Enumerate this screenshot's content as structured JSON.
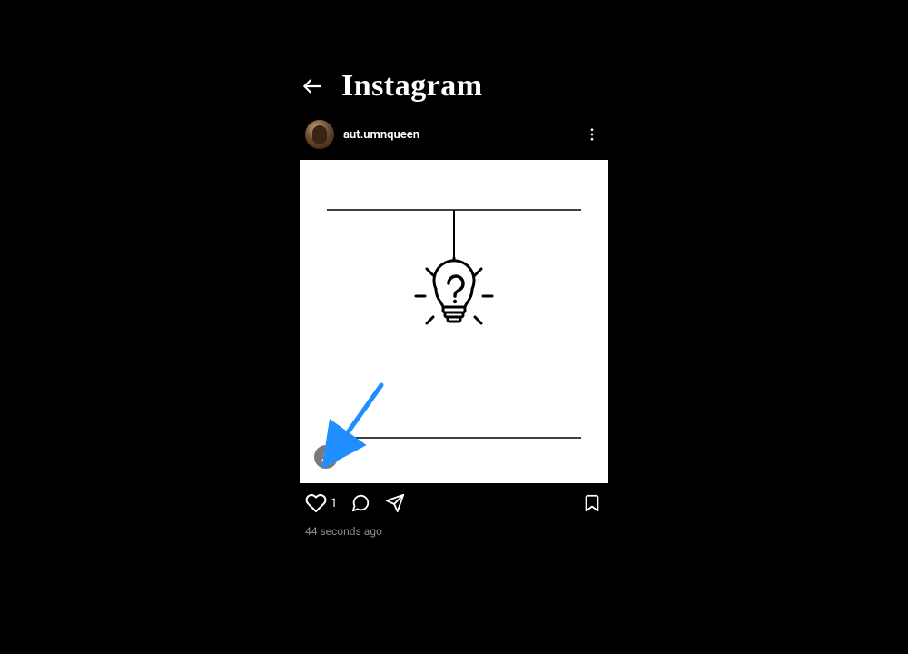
{
  "header": {
    "app_name": "Instagram"
  },
  "post": {
    "username": "aut.umnqueen",
    "like_count": "1",
    "timestamp": "44 seconds ago"
  }
}
